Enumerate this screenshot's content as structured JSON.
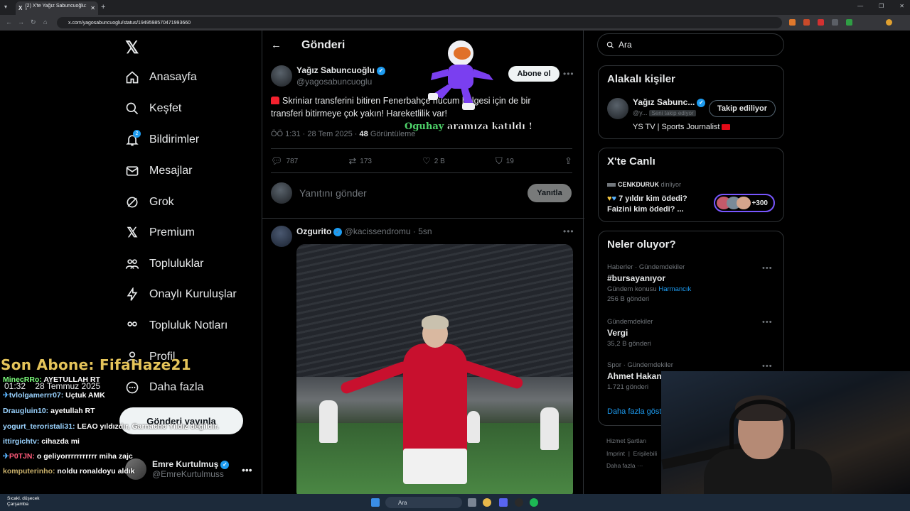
{
  "browser": {
    "tab_title": "(2) X'te Yağız Sabuncuoğlu: \"",
    "url": "x.com/yagosabuncuoglu/status/1949598570471993660"
  },
  "nav": {
    "items": [
      {
        "label": "Anasayfa",
        "icon": "home-icon"
      },
      {
        "label": "Keşfet",
        "icon": "search-icon"
      },
      {
        "label": "Bildirimler",
        "icon": "bell-icon",
        "badge": "2"
      },
      {
        "label": "Mesajlar",
        "icon": "mail-icon"
      },
      {
        "label": "Grok",
        "icon": "grok-icon"
      },
      {
        "label": "Premium",
        "icon": "x-icon"
      },
      {
        "label": "Topluluklar",
        "icon": "communities-icon"
      },
      {
        "label": "Onaylı Kuruluşlar",
        "icon": "lightning-icon"
      },
      {
        "label": "Topluluk Notları",
        "icon": "notes-icon"
      },
      {
        "label": "Profil",
        "icon": "person-icon"
      },
      {
        "label": "Daha fazla",
        "icon": "more-circle-icon"
      }
    ],
    "post_button": "Gönderi yayınla",
    "account": {
      "name": "Emre Kurtulmuş",
      "handle": "@EmreKurtulmuss"
    }
  },
  "post": {
    "header": "Gönderi",
    "author": {
      "name": "Yağız Sabuncuoğlu",
      "handle": "@yagosabuncuoglu"
    },
    "subscribe": "Abone ol",
    "text_line1": "Skriniar transferini bitiren Fenerbahçe hücum bölgesi için de bir",
    "text_line2": "transferi bitirmeye çok yakın! Hareketlilik var!",
    "time": "ÖÖ 1:31 · 28 Tem 2025 · ",
    "views": "48",
    "views_label": " Görüntüleme",
    "stats": {
      "replies": "787",
      "reposts": "173",
      "likes": "2 B",
      "bookmarks": "19"
    },
    "reply_placeholder": "Yanıtını gönder",
    "reply_button": "Yanıtla"
  },
  "reply": {
    "name": "Ozgurito",
    "handle_time": "@kacissendromu · 5sn"
  },
  "right": {
    "search_placeholder": "Ara",
    "relevant": {
      "title": "Alakalı kişiler",
      "name": "Yağız Sabunc...",
      "handle": "@y...",
      "follows_you": "Seni takip ediyor",
      "button": "Takip ediliyor",
      "bio": "YS TV | Sports Journalist"
    },
    "live": {
      "title": "X'te Canlı",
      "host": "CENKDURUK",
      "host_suffix": " dinliyor",
      "line1": "7 yıldır kim ödedi?",
      "line2": "Faizini kim ödedi? ...",
      "count": "+300"
    },
    "trends": {
      "title": "Neler oluyor?",
      "items": [
        {
          "category": "Haberler · Gündemdekiler",
          "name": "#bursayanıyor",
          "sub_prefix": "Gündem konusu ",
          "sub_link": "Harmancık",
          "count": "256 B gönderi"
        },
        {
          "category": "Gündemdekiler",
          "name": "Vergi",
          "count": "35,2 B gönderi"
        },
        {
          "category": "Spor · Gündemdekiler",
          "name": "Ahmet Hakan",
          "count": "1.721 gönderi"
        }
      ],
      "show_more": "Daha fazla göst"
    },
    "footer": {
      "line1": "Hizmet Şartları",
      "line2a": "Imprint",
      "line2b": "Erişilebili",
      "line3": "Daha fazla ···"
    }
  },
  "overlay": {
    "joined_name": "Oguhay",
    "joined_text": " aramıza katıldı !",
    "sub_banner": "Son Abone: FifaHaze21",
    "time": "01:32",
    "date": "28 Temmuz 2025",
    "chat": [
      {
        "user": "MinecRRo:",
        "msg": " AYETULLAH RT",
        "color": "#7cff7c"
      },
      {
        "user": "tvlolgamerrr07:",
        "msg": " Uçtuk AMK",
        "color": "#5ab4ff"
      },
      {
        "user": "Draugluin10:",
        "msg": " ayetullah RT",
        "color": "#9ad3ff"
      },
      {
        "user": "yogurt_teroristali31:",
        "msg": " LEAO yıldızdır, Garnacho Yıldız değildir.",
        "color": "#9ad3ff"
      },
      {
        "user": "ittirgichtv:",
        "msg": " cihazda mi",
        "color": "#9ad3ff"
      },
      {
        "user": "P0TJN:",
        "msg": " o geliyorrrrrrrrrrr miha zajc",
        "color": "#ff5a7a"
      },
      {
        "user": "komputerinho:",
        "msg": " noldu ronaldoyu aldık",
        "color": "#c9b06a"
      }
    ]
  },
  "taskbar": {
    "weather": "Sıcakl. düşecek",
    "day": "Çarşamba",
    "search": "Ara"
  },
  "colors": {
    "accent": "#1d9bf0",
    "bg": "#000000",
    "border": "#2f3336",
    "muted": "#71767b",
    "live": "#7856ff"
  }
}
